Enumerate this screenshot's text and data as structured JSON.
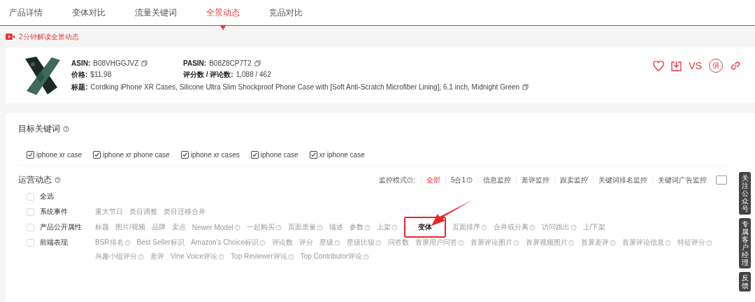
{
  "tabs": [
    {
      "label": "产品详情",
      "selected": false
    },
    {
      "label": "变体对比",
      "selected": false
    },
    {
      "label": "流量关键词",
      "selected": false
    },
    {
      "label": "全景动态",
      "selected": true
    },
    {
      "label": "竞品对比",
      "selected": false
    }
  ],
  "video_link": "2分钟解读全景动态",
  "product": {
    "asin_label": "ASIN:",
    "asin": "B08VHGGJVZ",
    "pasin_label": "PASIN:",
    "pasin": "B08Z8CP7T2",
    "price_label": "价格:",
    "price": "$11.98",
    "rating_label": "评分数 / 评论数:",
    "rating": "1,088 / 462",
    "title_label": "标题:",
    "title": "Cordking iPhone XR Cases, Silicone Ultra Slim Shockproof Phone Case with [Soft Anti-Scratch Microfiber Lining], 6.1 inch, Midnight Green",
    "actions": [
      {
        "kind": "heart"
      },
      {
        "kind": "download"
      },
      {
        "kind": "text",
        "label": "VS"
      },
      {
        "kind": "circle",
        "label": "供"
      },
      {
        "kind": "link"
      }
    ]
  },
  "keywords": {
    "title": "目标关键词",
    "items": [
      {
        "label": "iphone xr case",
        "checked": true
      },
      {
        "label": "iphone xr phone case",
        "checked": true
      },
      {
        "label": "iphone xr cases",
        "checked": true
      },
      {
        "label": "iphone case",
        "checked": true
      },
      {
        "label": "xr iphone case",
        "checked": true
      }
    ]
  },
  "operations": {
    "title": "运营动态",
    "mode_label": "监控模式",
    "mode_suffix": ":",
    "modes": [
      {
        "label": "全部",
        "selected": true,
        "help": false
      },
      {
        "label": "5合1",
        "selected": false,
        "help": true
      },
      {
        "label": "信息监控",
        "selected": false,
        "help": false
      },
      {
        "label": "差评监控",
        "selected": false,
        "help": false
      },
      {
        "label": "跟卖监控",
        "selected": false,
        "help": false
      },
      {
        "label": "关键词排名监控",
        "selected": false,
        "help": false
      },
      {
        "label": "关键词广告监控",
        "selected": false,
        "help": false
      }
    ],
    "select_all": {
      "label": "全选",
      "checked": false
    },
    "groups": [
      {
        "label": "系统事件",
        "checked": false,
        "rows": [
          [
            {
              "label": "重大节日",
              "help": false,
              "highlighted": false
            },
            {
              "label": "类目调整",
              "help": false,
              "highlighted": false
            },
            {
              "label": "类目迁移合并",
              "help": false,
              "highlighted": false
            }
          ]
        ]
      },
      {
        "label": "产品公开属性",
        "checked": false,
        "rows": [
          [
            {
              "label": "标题",
              "help": false,
              "highlighted": false
            },
            {
              "label": "图片/视频",
              "help": false,
              "highlighted": false
            },
            {
              "label": "品牌",
              "help": false,
              "highlighted": false
            },
            {
              "label": "卖点",
              "help": false,
              "highlighted": false
            },
            {
              "label": "Newer Model",
              "help": true,
              "highlighted": false
            },
            {
              "label": "一起购买",
              "help": true,
              "highlighted": false
            },
            {
              "label": "页面质量",
              "help": true,
              "highlighted": false
            },
            {
              "label": "描述",
              "help": false,
              "highlighted": false
            },
            {
              "label": "参数",
              "help": true,
              "highlighted": false
            },
            {
              "label": "上架",
              "help": true,
              "highlighted": false
            },
            {
              "label": "变体",
              "help": false,
              "highlighted": true
            },
            {
              "label": "页面排序",
              "help": true,
              "highlighted": false
            },
            {
              "label": "合并或分离",
              "help": true,
              "highlighted": false
            },
            {
              "label": "访问跳出",
              "help": true,
              "highlighted": false
            },
            {
              "label": "上/下架",
              "help": false,
              "highlighted": false
            }
          ]
        ]
      },
      {
        "label": "前端表现",
        "checked": false,
        "rows": [
          [
            {
              "label": "BSR排名",
              "help": true,
              "highlighted": false
            },
            {
              "label": "Best Seller标识",
              "help": false,
              "highlighted": false
            },
            {
              "label": "Amazon's Choice标识",
              "help": true,
              "highlighted": false
            },
            {
              "label": "评论数",
              "help": false,
              "highlighted": false
            },
            {
              "label": "评分",
              "help": false,
              "highlighted": false
            },
            {
              "label": "星级",
              "help": true,
              "highlighted": false
            },
            {
              "label": "星级比较",
              "help": true,
              "highlighted": false
            },
            {
              "label": "问答数",
              "help": false,
              "highlighted": false
            },
            {
              "label": "首屏用户问答",
              "help": true,
              "highlighted": false
            },
            {
              "label": "首屏评论图片",
              "help": true,
              "highlighted": false
            },
            {
              "label": "首屏视频图片",
              "help": true,
              "highlighted": false
            },
            {
              "label": "首屏差评",
              "help": true,
              "highlighted": false
            },
            {
              "label": "首屏评论信息",
              "help": true,
              "highlighted": false
            },
            {
              "label": "特征评分",
              "help": true,
              "highlighted": false
            }
          ],
          [
            {
              "label": "兴趣小组评分",
              "help": true,
              "highlighted": false
            },
            {
              "label": "差评",
              "help": false,
              "highlighted": false
            },
            {
              "label": "Vine Voice评论",
              "help": true,
              "highlighted": false
            },
            {
              "label": "Top Reviewer评论",
              "help": true,
              "highlighted": false
            },
            {
              "label": "Top Contributor评论",
              "help": true,
              "highlighted": false
            }
          ]
        ]
      }
    ]
  },
  "side_tabs": [
    {
      "label": "关注公众号"
    },
    {
      "label": "专属客户经理"
    },
    {
      "label": "反馈"
    }
  ]
}
